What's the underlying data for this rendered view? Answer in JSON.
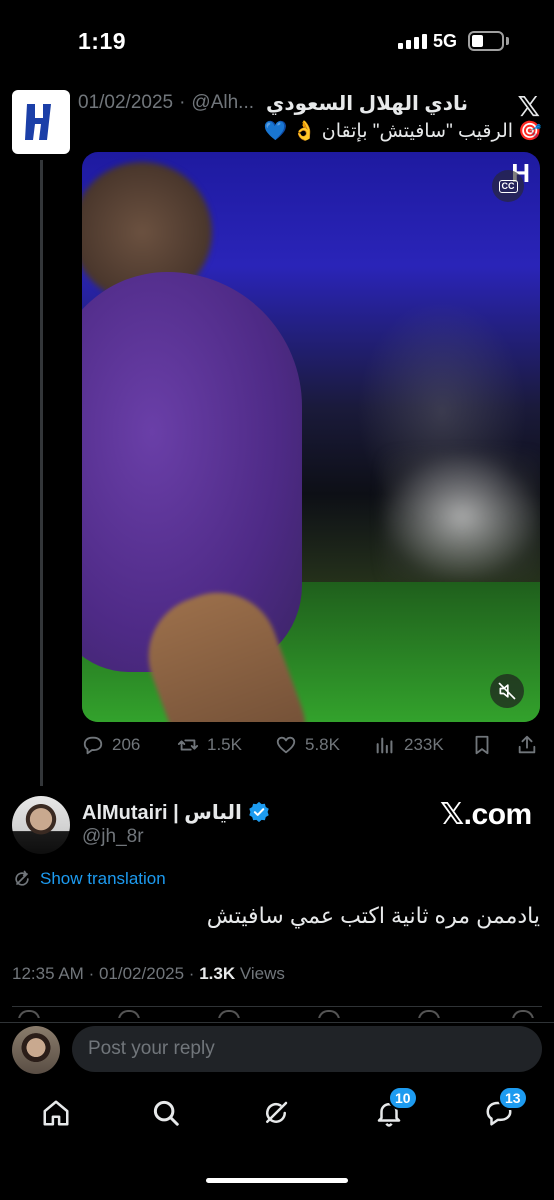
{
  "status_bar": {
    "time": "1:19",
    "network": "5G"
  },
  "quoted_tweet": {
    "author_name": "نادي الهلال السعودي",
    "handle": "@Alh...",
    "separator": "·",
    "date": "01/02/2025",
    "text": "🎯 الرقيب \"سافيتش\" بإتقان 👌 💙",
    "video_watermark": "H",
    "video_cc_label": "CC",
    "stats": {
      "replies": "206",
      "reposts": "1.5K",
      "likes": "5.8K",
      "views": "233K"
    }
  },
  "tweet": {
    "author_name": "AlMutairi | الياس",
    "handle": "@jh_8r",
    "watermark": "𝕏.com",
    "show_translation": "Show translation",
    "text": "يادممن مره ثانية اكتب عمي سافيتش",
    "time": "12:35 AM",
    "date": "01/02/2025",
    "separator": "·",
    "views_count": "1.3K",
    "views_label": "Views"
  },
  "reply": {
    "placeholder": "Post your reply"
  },
  "nav": {
    "items": [
      "home-icon",
      "search-icon",
      "grok-icon",
      "notifications-icon",
      "messages-icon"
    ],
    "notifications_badge": "10",
    "messages_badge": "13"
  },
  "colors": {
    "accent": "#1d9bf0",
    "background": "#000000",
    "muted": "#71767b",
    "verified": "#1d9bf0",
    "gold_verified": "#e2b719"
  }
}
